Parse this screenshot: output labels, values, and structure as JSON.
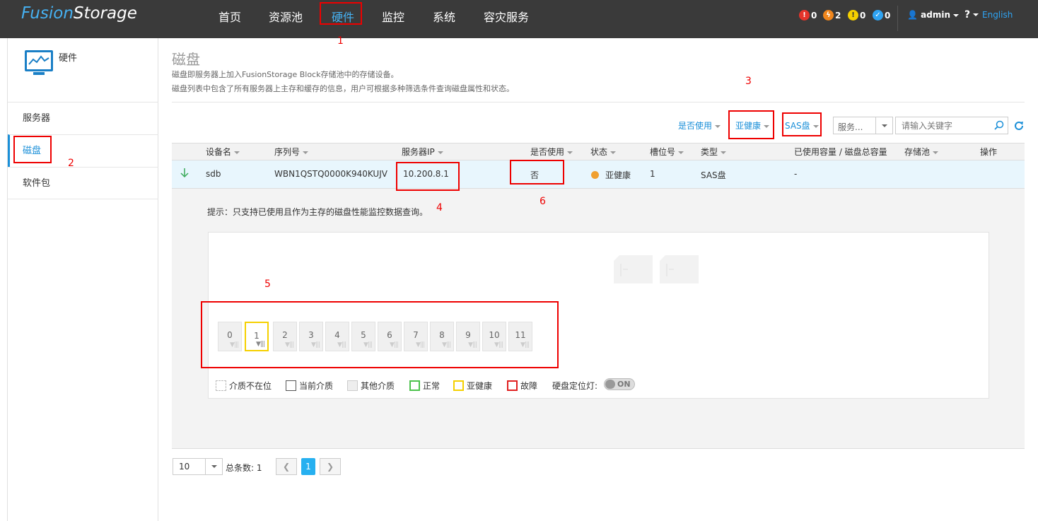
{
  "header": {
    "logo_prefix": "Fusion",
    "logo_suffix": "Storage",
    "nav": [
      "首页",
      "资源池",
      "硬件",
      "监控",
      "系统",
      "容灾服务"
    ],
    "alarms": [
      {
        "count": "0",
        "color": "#e5342b",
        "icon": "critical-alarm-icon"
      },
      {
        "count": "2",
        "color": "#f0861c",
        "icon": "major-alarm-icon"
      },
      {
        "count": "0",
        "color": "#f5d000",
        "icon": "minor-alarm-icon"
      },
      {
        "count": "0",
        "color": "#2ea3f2",
        "icon": "warning-alarm-icon"
      }
    ],
    "user": "admin",
    "help": "?",
    "language": "English"
  },
  "sidebar": {
    "title": "硬件",
    "items": [
      "服务器",
      "磁盘",
      "软件包"
    ]
  },
  "page": {
    "title": "磁盘",
    "desc1": "磁盘即服务器上加入FusionStorage Block存储池中的存储设备。",
    "desc2": "磁盘列表中包含了所有服务器上主存和缓存的信息，用户可根据多种筛选条件查询磁盘属性和状态。"
  },
  "filters": {
    "in_use": "是否使用",
    "health": "亚健康",
    "disk_type": "SAS盘",
    "server_select": "服务...",
    "search_placeholder": "请输入关键字"
  },
  "table": {
    "headers": [
      "设备名",
      "序列号",
      "服务器IP",
      "是否使用",
      "状态",
      "槽位号",
      "类型",
      "已使用容量 / 磁盘总容量",
      "存储池",
      "操作"
    ],
    "row": {
      "device": "sdb",
      "serial": "WBN1QSTQ0000K940KUJV",
      "ip": "10.200.8.1",
      "in_use": "否",
      "status": "亚健康",
      "slot": "1",
      "type": "SAS盘",
      "capacity": "-"
    }
  },
  "detail": {
    "hint": "提示：只支持已使用且作为主存的磁盘性能监控数据查询。",
    "slots": [
      "0",
      "1",
      "2",
      "3",
      "4",
      "5",
      "6",
      "7",
      "8",
      "9",
      "10",
      "11"
    ],
    "legend": [
      "介质不在位",
      "当前介质",
      "其他介质",
      "正常",
      "亚健康",
      "故障"
    ],
    "locate_label": "硬盘定位灯:",
    "toggle": "ON"
  },
  "pagination": {
    "page_size": "10",
    "total": "总条数: 1",
    "current": "1"
  },
  "annotations": [
    "1",
    "2",
    "3",
    "4",
    "5",
    "6"
  ],
  "colors": {
    "accent": "#1a8fd8",
    "highlight_row": "#e8f6fd",
    "subhealth": "#f0a030",
    "annotation": "#e00000"
  }
}
